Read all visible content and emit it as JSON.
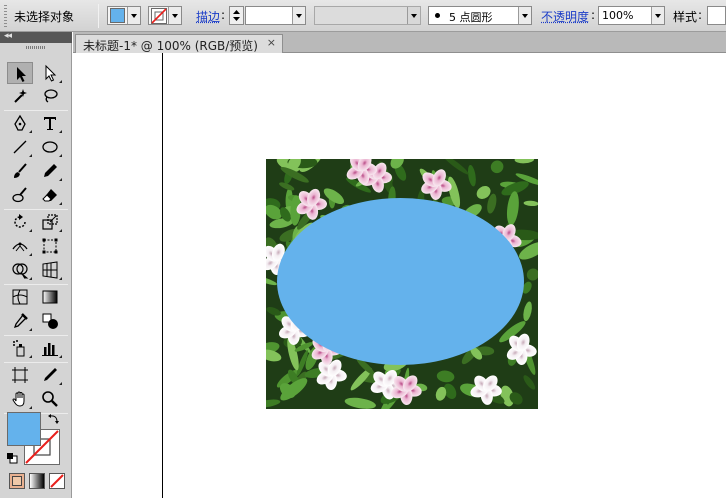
{
  "control_bar": {
    "selection_status": "未选择对象",
    "stroke_label": "描边",
    "stroke_weight": "",
    "brush_profile": "",
    "brush_label": "5 点圆形",
    "opacity_label": "不透明度",
    "opacity_value": "100%",
    "style_label": "样式",
    "colon": ":"
  },
  "document": {
    "tab_title": "未标题-1* @ 100% (RGB/预览)",
    "close_glyph": "×"
  },
  "colors": {
    "fill": "#64b2ec",
    "stroke_none": "#e8201c",
    "ellipse_fill": "#64b2ec",
    "leaf_green": "#3d7d24",
    "flower_pink": "#e7a8c8"
  },
  "tools": [
    "selection-tool",
    "direct-selection-tool",
    "magic-wand-tool",
    "lasso-tool",
    "pen-tool",
    "type-tool",
    "line-segment-tool",
    "ellipse-tool",
    "paintbrush-tool",
    "pencil-tool",
    "blob-brush-tool",
    "eraser-tool",
    "rotate-tool",
    "scale-tool",
    "width-tool",
    "free-transform-tool",
    "shape-builder-tool",
    "perspective-grid-tool",
    "mesh-tool",
    "gradient-tool",
    "eyedropper-tool",
    "blend-tool",
    "symbol-sprayer-tool",
    "column-graph-tool",
    "artboard-tool",
    "slice-tool",
    "hand-tool",
    "zoom-tool"
  ]
}
